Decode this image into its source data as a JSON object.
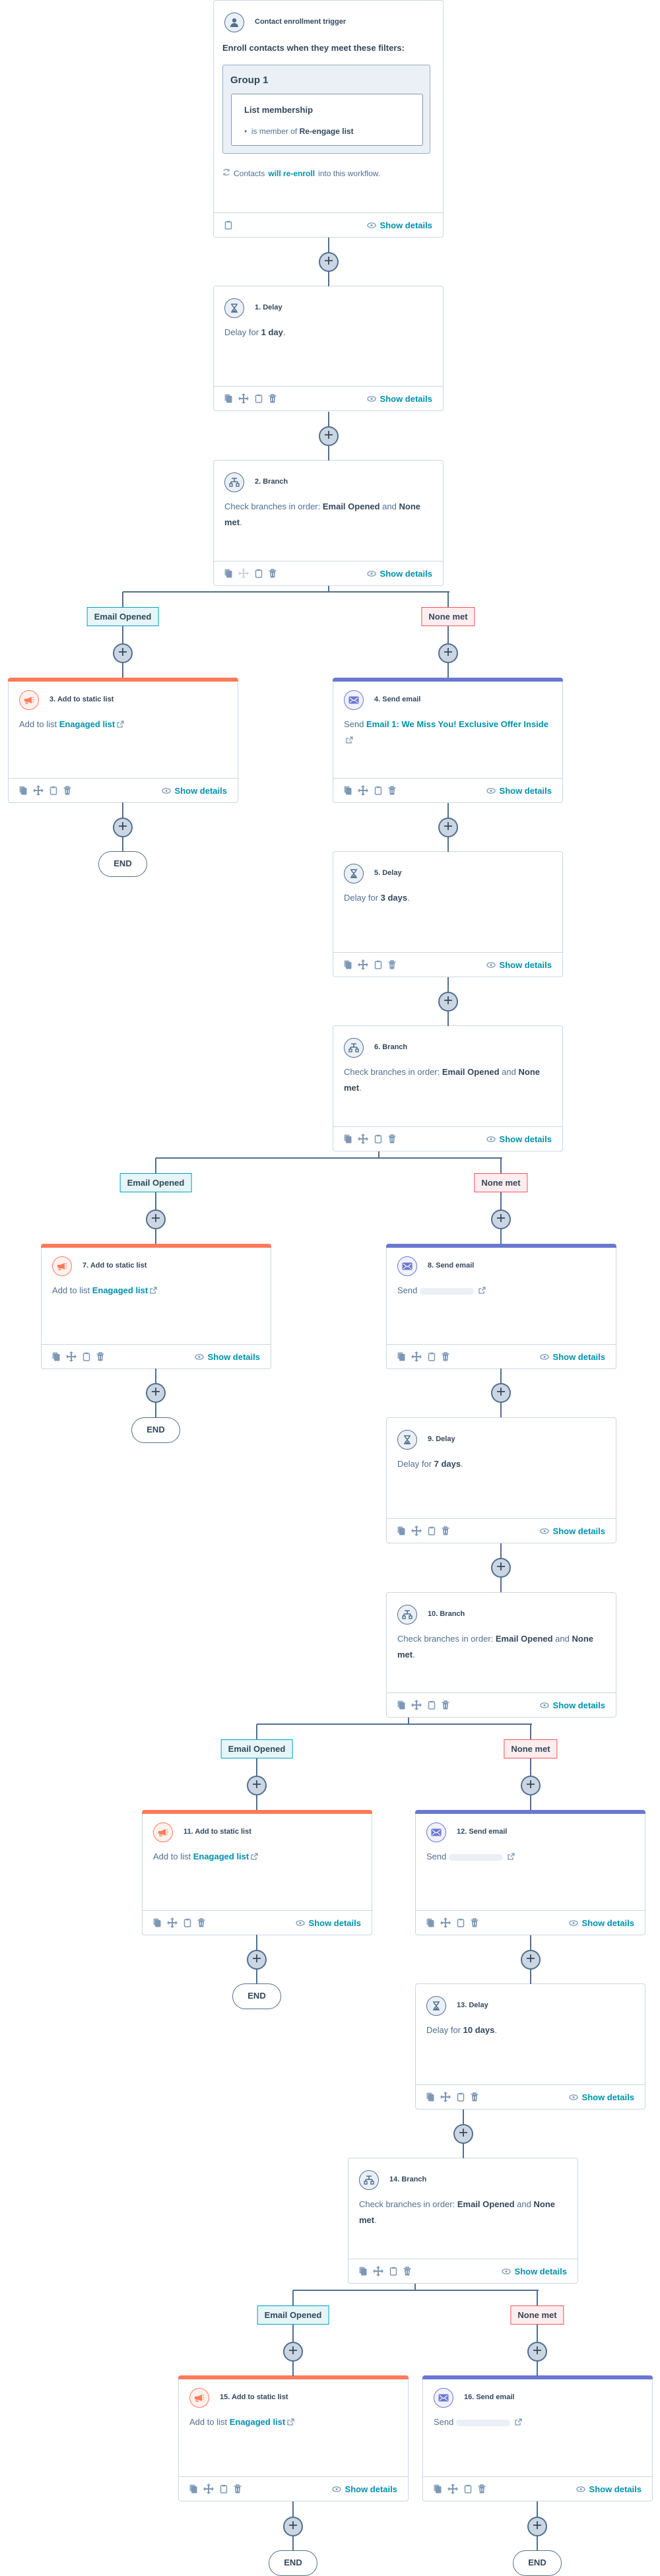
{
  "trigger": {
    "title": "Contact enrollment trigger",
    "heading": "Enroll contacts when they meet these filters:",
    "group_title": "Group 1",
    "filter_title": "List membership",
    "filter_prefix": "is member of",
    "filter_value": "Re-engage list",
    "reenroll_prefix": "Contacts",
    "reenroll_link": "will re-enroll",
    "reenroll_suffix": "into this workflow.",
    "icon": "contact-icon"
  },
  "show_details_label": "Show details",
  "end_label": "END",
  "branch_labels": {
    "left": "Email Opened",
    "right": "None met"
  },
  "colors": {
    "text": "#33475b",
    "link": "#0091ae",
    "connector": "#516f90",
    "static_list_accent": "#ff7a59",
    "send_email_accent": "#6a78d1",
    "email_opened_border": "#00a4bd",
    "none_met_border": "#f2545b"
  },
  "steps": [
    {
      "id": 1,
      "type": "delay",
      "title": "1. Delay",
      "body": [
        {
          "t": "Delay for ",
          "s": "plain"
        },
        {
          "t": "1 day",
          "s": "bold"
        },
        {
          "t": ".",
          "s": "plain"
        }
      ]
    },
    {
      "id": 2,
      "type": "branch",
      "title": "2. Branch",
      "move_disabled": true,
      "body": [
        {
          "t": "Check branches in order: ",
          "s": "plain"
        },
        {
          "t": "Email Opened",
          "s": "bold"
        },
        {
          "t": " and ",
          "s": "plain"
        },
        {
          "t": "None met",
          "s": "bold"
        },
        {
          "t": ".",
          "s": "plain"
        }
      ]
    },
    {
      "id": 3,
      "type": "list",
      "title": "3. Add to static list",
      "body": [
        {
          "t": "Add to list ",
          "s": "plain"
        },
        {
          "t": "Enagaged list",
          "s": "link"
        }
      ]
    },
    {
      "id": 4,
      "type": "email",
      "title": "4. Send email",
      "body": [
        {
          "t": "Send ",
          "s": "plain"
        },
        {
          "t": "Email 1: We Miss You! Exclusive Offer Inside",
          "s": "link"
        }
      ]
    },
    {
      "id": 5,
      "type": "delay",
      "title": "5. Delay",
      "body": [
        {
          "t": "Delay for ",
          "s": "plain"
        },
        {
          "t": "3 days",
          "s": "bold"
        },
        {
          "t": ".",
          "s": "plain"
        }
      ]
    },
    {
      "id": 6,
      "type": "branch",
      "title": "6. Branch",
      "body": [
        {
          "t": "Check branches in order: ",
          "s": "plain"
        },
        {
          "t": "Email Opened",
          "s": "bold"
        },
        {
          "t": " and ",
          "s": "plain"
        },
        {
          "t": "None met",
          "s": "bold"
        },
        {
          "t": ".",
          "s": "plain"
        }
      ]
    },
    {
      "id": 7,
      "type": "list",
      "title": "7. Add to static list",
      "body": [
        {
          "t": "Add to list ",
          "s": "plain"
        },
        {
          "t": "Enagaged list",
          "s": "link"
        }
      ]
    },
    {
      "id": 8,
      "type": "email",
      "title": "8. Send email",
      "body": [
        {
          "t": "Send",
          "s": "plain"
        },
        {
          "t": "",
          "s": "redacted"
        }
      ]
    },
    {
      "id": 9,
      "type": "delay",
      "title": "9. Delay",
      "body": [
        {
          "t": "Delay for ",
          "s": "plain"
        },
        {
          "t": "7 days",
          "s": "bold"
        },
        {
          "t": ".",
          "s": "plain"
        }
      ]
    },
    {
      "id": 10,
      "type": "branch",
      "title": "10. Branch",
      "body": [
        {
          "t": "Check branches in order: ",
          "s": "plain"
        },
        {
          "t": "Email Opened",
          "s": "bold"
        },
        {
          "t": " and ",
          "s": "plain"
        },
        {
          "t": "None met",
          "s": "bold"
        },
        {
          "t": ".",
          "s": "plain"
        }
      ]
    },
    {
      "id": 11,
      "type": "list",
      "title": "11. Add to static list",
      "body": [
        {
          "t": "Add to list ",
          "s": "plain"
        },
        {
          "t": "Enagaged list",
          "s": "link"
        }
      ]
    },
    {
      "id": 12,
      "type": "email",
      "title": "12. Send email",
      "body": [
        {
          "t": "Send",
          "s": "plain"
        },
        {
          "t": "",
          "s": "redacted"
        }
      ]
    },
    {
      "id": 13,
      "type": "delay",
      "title": "13. Delay",
      "body": [
        {
          "t": "Delay for ",
          "s": "plain"
        },
        {
          "t": "10 days",
          "s": "bold"
        },
        {
          "t": ".",
          "s": "plain"
        }
      ]
    },
    {
      "id": 14,
      "type": "branch",
      "title": "14. Branch",
      "body": [
        {
          "t": "Check branches in order: ",
          "s": "plain"
        },
        {
          "t": "Email Opened",
          "s": "bold"
        },
        {
          "t": " and ",
          "s": "plain"
        },
        {
          "t": "None met",
          "s": "bold"
        },
        {
          "t": ".",
          "s": "plain"
        }
      ]
    },
    {
      "id": 15,
      "type": "list",
      "title": "15. Add to static list",
      "body": [
        {
          "t": "Add to list ",
          "s": "plain"
        },
        {
          "t": "Enagaged list",
          "s": "link"
        }
      ]
    },
    {
      "id": 16,
      "type": "email",
      "title": "16. Send email",
      "body": [
        {
          "t": "Send",
          "s": "plain"
        },
        {
          "t": "",
          "s": "redacted"
        }
      ]
    }
  ]
}
